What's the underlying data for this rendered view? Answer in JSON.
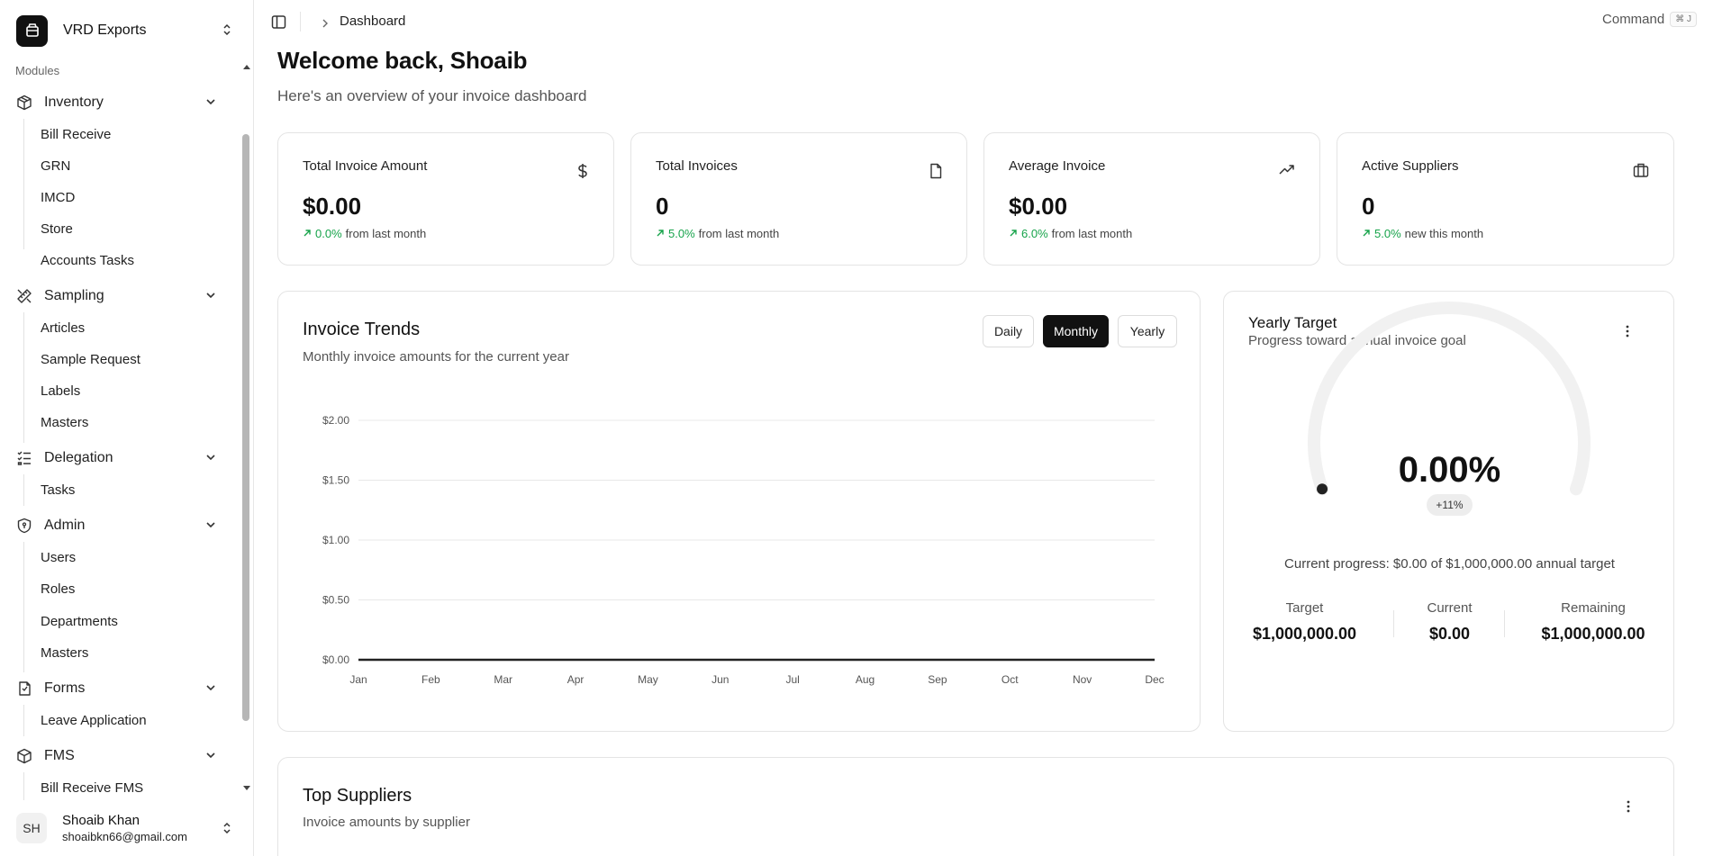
{
  "sidebar": {
    "org_name": "VRD Exports",
    "modules_label": "Modules",
    "groups": [
      {
        "label": "Inventory",
        "icon": "package-icon",
        "items": [
          "Bill Receive",
          "GRN",
          "IMCD",
          "Store",
          "Accounts Tasks"
        ]
      },
      {
        "label": "Sampling",
        "icon": "ruler-pencil-icon",
        "items": [
          "Articles",
          "Sample Request",
          "Labels",
          "Masters"
        ]
      },
      {
        "label": "Delegation",
        "icon": "list-checks-icon",
        "items": [
          "Tasks"
        ]
      },
      {
        "label": "Admin",
        "icon": "shield-icon",
        "items": [
          "Users",
          "Roles",
          "Departments",
          "Masters"
        ]
      },
      {
        "label": "Forms",
        "icon": "form-icon",
        "items": [
          "Leave Application"
        ]
      },
      {
        "label": "FMS",
        "icon": "package-icon",
        "items": [
          "Bill Receive FMS"
        ]
      }
    ],
    "user": {
      "initials": "SH",
      "name": "Shoaib Khan",
      "email": "shoaibkn66@gmail.com"
    }
  },
  "header": {
    "breadcrumb": "Dashboard",
    "command_label": "Command",
    "command_kbd": "⌘ J"
  },
  "main": {
    "welcome": "Welcome back, Shoaib",
    "subtitle": "Here's an overview of your invoice dashboard",
    "stats": [
      {
        "title": "Total Invoice Amount",
        "value": "$0.00",
        "pct": "0.0%",
        "suffix": "from last month",
        "icon": "dollar-icon"
      },
      {
        "title": "Total Invoices",
        "value": "0",
        "pct": "5.0%",
        "suffix": "from last month",
        "icon": "file-icon"
      },
      {
        "title": "Average Invoice",
        "value": "$0.00",
        "pct": "6.0%",
        "suffix": "from last month",
        "icon": "trending-up-icon"
      },
      {
        "title": "Active Suppliers",
        "value": "0",
        "pct": "5.0%",
        "suffix": "new this month",
        "icon": "building-icon"
      }
    ],
    "trends": {
      "title": "Invoice Trends",
      "subtitle": "Monthly invoice amounts for the current year",
      "tabs": [
        "Daily",
        "Monthly",
        "Yearly"
      ],
      "active_tab": "Monthly"
    },
    "target": {
      "title": "Yearly Target",
      "subtitle": "Progress toward annual invoice goal",
      "percent": "0.00%",
      "progress": 0,
      "badge": "+11%",
      "progress_text": "Current progress: $0.00 of $1,000,000.00 annual target",
      "target_label": "Target",
      "target_value": "$1,000,000.00",
      "current_label": "Current",
      "current_value": "$0.00",
      "remaining_label": "Remaining",
      "remaining_value": "$1,000,000.00"
    },
    "suppliers": {
      "title": "Top Suppliers",
      "subtitle": "Invoice amounts by supplier"
    }
  },
  "chart_data": {
    "type": "line",
    "categories": [
      "Jan",
      "Feb",
      "Mar",
      "Apr",
      "May",
      "Jun",
      "Jul",
      "Aug",
      "Sep",
      "Oct",
      "Nov",
      "Dec"
    ],
    "series": [
      {
        "values": [
          0,
          0,
          0,
          0,
          0,
          0,
          0,
          0,
          0,
          0,
          0,
          0
        ]
      }
    ],
    "y_ticks": [
      "$0.00",
      "$0.50",
      "$1.00",
      "$1.50",
      "$2.00"
    ],
    "ylim": [
      0,
      2
    ],
    "grid": true,
    "line_color": "#222222"
  }
}
